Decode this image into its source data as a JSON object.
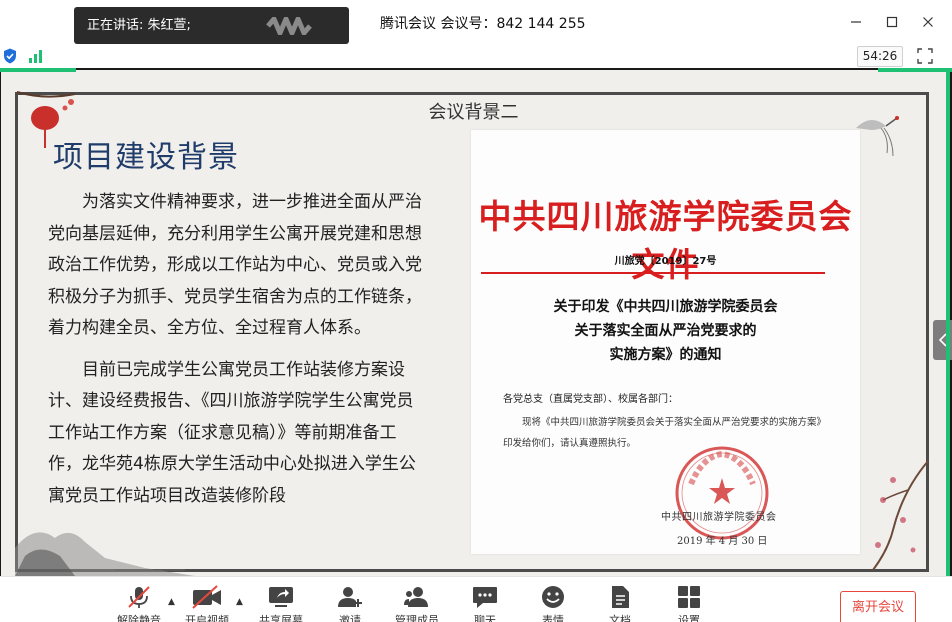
{
  "window": {
    "title": "腾讯会议 会议号：842 144 255",
    "speaking_label": "正在讲话: 朱红萱;",
    "timer": "54:26",
    "controls": [
      "minimize",
      "maximize",
      "close"
    ]
  },
  "slide": {
    "header": "会议背景二",
    "project_title": "项目建设背景",
    "paragraphs": [
      "为落实文件精神要求，进一步推进全面从严治党向基层延伸，充分利用学生公寓开展党建和思想政治工作优势，形成以工作站为中心、党员或入党积极分子为抓手、党员学生宿舍为点的工作链条，着力构建全员、全方位、全过程育人体系。",
      "目前已完成学生公寓党员工作站装修方案设计、建设经费报告、《四川旅游学院学生公寓党员工作站工作方案（征求意见稿）》等前期准备工作，龙华苑4栋原大学生活动中心处拟进入学生公寓党员工作站项目改造装修阶段"
    ],
    "document": {
      "title": "中共四川旅游学院委员会文件",
      "number": "川旅党〔2019〕27号",
      "subject_lines": [
        "关于印发《中共四川旅游学院委员会",
        "关于落实全面从严治党要求的",
        "实施方案》的通知"
      ],
      "addressee": "各党总支（直属党支部）、校属各部门：",
      "body": "现将《中共四川旅游学院委员会关于落实全面从严治党要求的实施方案》印发给你们，请认真遵照执行。",
      "issuer": "中共四川旅游学院委员会",
      "date": "2019 年 4 月 30 日",
      "seal_text": "中共四川旅游学院委员会"
    }
  },
  "toolbar": {
    "items": [
      {
        "label": "解除静音",
        "icon": "mic-muted-icon"
      },
      {
        "label": "开启视频",
        "icon": "video-off-icon"
      },
      {
        "label": "共享屏幕",
        "icon": "share-screen-icon"
      },
      {
        "label": "邀请",
        "icon": "invite-icon"
      },
      {
        "label": "管理成员",
        "icon": "members-icon"
      },
      {
        "label": "聊天",
        "icon": "chat-icon"
      },
      {
        "label": "表情",
        "icon": "emoji-icon"
      },
      {
        "label": "文档",
        "icon": "doc-icon"
      },
      {
        "label": "设置",
        "icon": "settings-icon"
      }
    ],
    "leave_label": "离开会议"
  },
  "colors": {
    "accent_green": "#1fbf74",
    "leave_red": "#e6483d",
    "doc_red": "#d81e1e",
    "title_blue": "#1f3c6b"
  }
}
